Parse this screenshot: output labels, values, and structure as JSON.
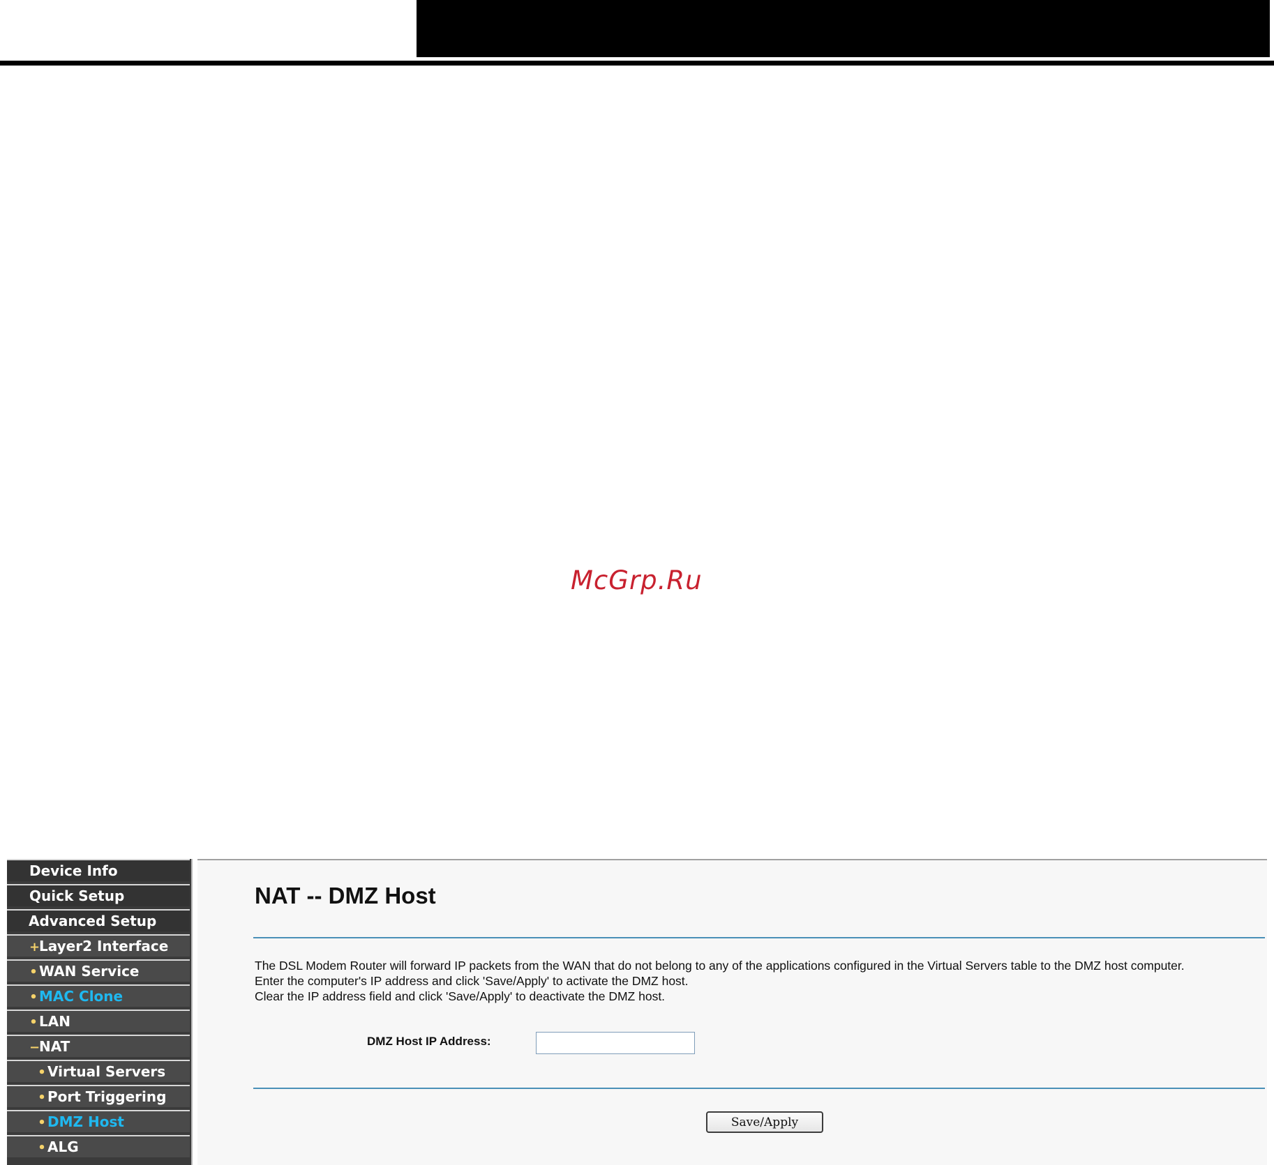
{
  "watermark": "McGrp.Ru",
  "sidebar": {
    "items": [
      {
        "label": "Device Info",
        "marker": ""
      },
      {
        "label": "Quick Setup",
        "marker": ""
      },
      {
        "label": "Advanced Setup",
        "marker": ""
      },
      {
        "label": "Layer2 Interface",
        "marker": "+"
      },
      {
        "label": "WAN Service",
        "marker": "•"
      },
      {
        "label": "MAC Clone",
        "marker": "•"
      },
      {
        "label": "LAN",
        "marker": "•"
      },
      {
        "label": "NAT",
        "marker": "−"
      },
      {
        "label": "Virtual Servers",
        "marker": "•"
      },
      {
        "label": "Port Triggering",
        "marker": "•"
      },
      {
        "label": "DMZ Host",
        "marker": "•"
      },
      {
        "label": "ALG",
        "marker": "•"
      }
    ]
  },
  "main": {
    "title": "NAT -- DMZ Host",
    "description": [
      "The DSL Modem Router will forward IP packets from the WAN that do not belong to any of the applications configured in the Virtual Servers table to the DMZ host computer.",
      "Enter the computer's IP address and click 'Save/Apply' to activate the DMZ host.",
      "Clear the IP address field and click 'Save/Apply' to deactivate the DMZ host."
    ],
    "ip_label": "DMZ Host IP Address:",
    "ip_value": "",
    "save_label": "Save/Apply"
  },
  "colors": {
    "active_nav_text": "#1fb8f0",
    "nav_marker": "#f5d26a",
    "rule": "#4a90b8",
    "watermark": "#c8212f"
  }
}
